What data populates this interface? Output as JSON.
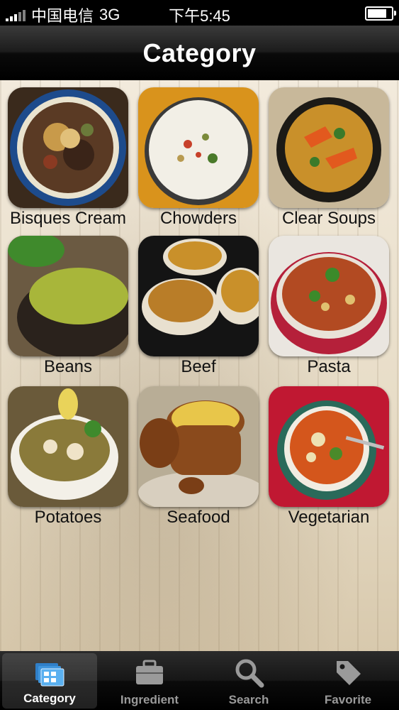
{
  "status_bar": {
    "carrier": "中国电信",
    "network": "3G",
    "time": "下午5:45"
  },
  "nav": {
    "title": "Category"
  },
  "categories": [
    {
      "label": "Bisques Cream"
    },
    {
      "label": "Chowders"
    },
    {
      "label": "Clear Soups"
    },
    {
      "label": "Beans"
    },
    {
      "label": "Beef"
    },
    {
      "label": "Pasta"
    },
    {
      "label": "Potatoes"
    },
    {
      "label": "Seafood"
    },
    {
      "label": "Vegetarian"
    }
  ],
  "tabs": [
    {
      "label": "Category",
      "icon": "category-icon",
      "selected": true
    },
    {
      "label": "Ingredient",
      "icon": "briefcase-icon",
      "selected": false
    },
    {
      "label": "Search",
      "icon": "search-icon",
      "selected": false
    },
    {
      "label": "Favorite",
      "icon": "tag-icon",
      "selected": false
    }
  ],
  "colors": {
    "active_tab_icon": "#4aa3e8",
    "inactive": "#9a9a9a"
  }
}
